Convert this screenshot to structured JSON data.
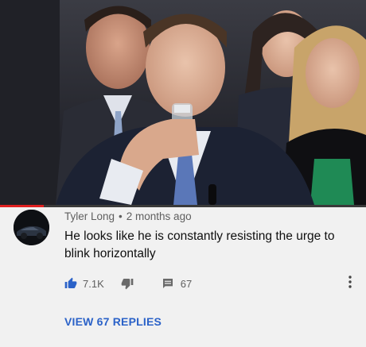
{
  "video": {
    "progress_fraction": 0.12,
    "colors": {
      "progress": "#e02020",
      "track": "#3a3a3a"
    }
  },
  "comment": {
    "author": "Tyler Long",
    "separator": "•",
    "time": "2 months ago",
    "text": "He looks like he is constantly resisting the urge to blink horizontally",
    "like_count": "7.1K",
    "reply_count": "67",
    "view_replies": "VIEW 67 REPLIES"
  },
  "icons": {
    "like": "thumbs-up-icon",
    "dislike": "thumbs-down-icon",
    "reply": "comment-icon",
    "menu": "more-vertical-icon"
  },
  "colors": {
    "accent": "#2b62c8",
    "like_active": "#2b62c8",
    "secondary_text": "#5f5f5f",
    "background": "#f1f1f1"
  }
}
